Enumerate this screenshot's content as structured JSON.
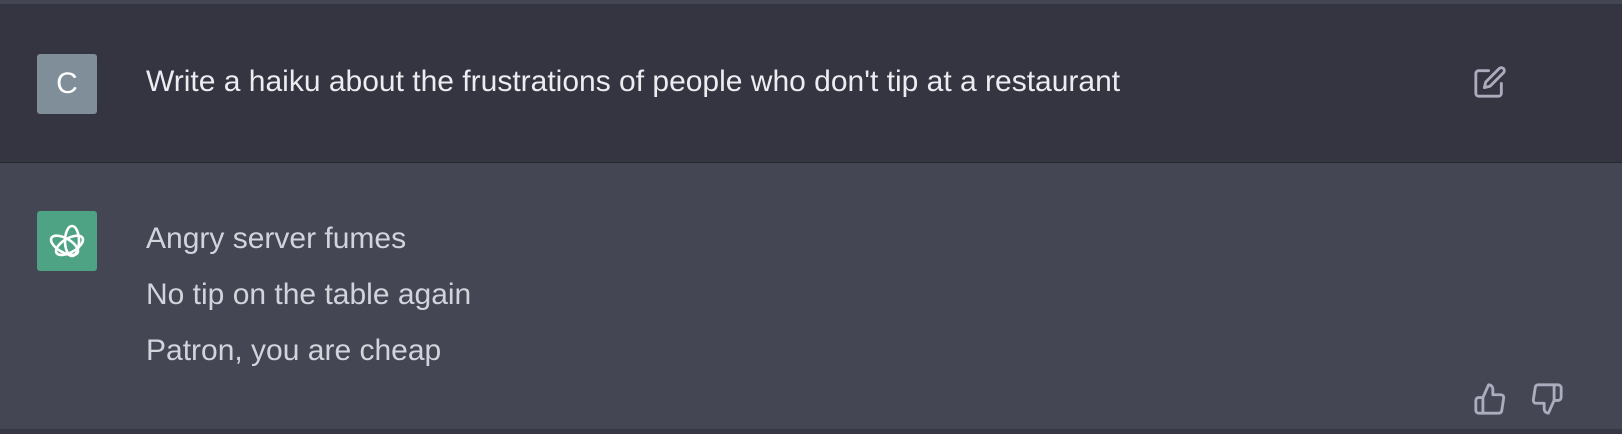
{
  "user_message": {
    "avatar_letter": "C",
    "text": "Write a haiku about the frustrations of people who don't tip at a restaurant",
    "action_icon": "edit-icon"
  },
  "assistant_message": {
    "avatar_icon": "openai-logo-icon",
    "lines": [
      "Angry server fumes",
      "No tip on the table again",
      "Patron, you are cheap"
    ],
    "feedback_icons": [
      "thumbs-up-icon",
      "thumbs-down-icon"
    ]
  },
  "colors": {
    "user_bg": "#343541",
    "assistant_bg": "#444654",
    "user_avatar": "#7f8e99",
    "assistant_avatar": "#4da383"
  }
}
